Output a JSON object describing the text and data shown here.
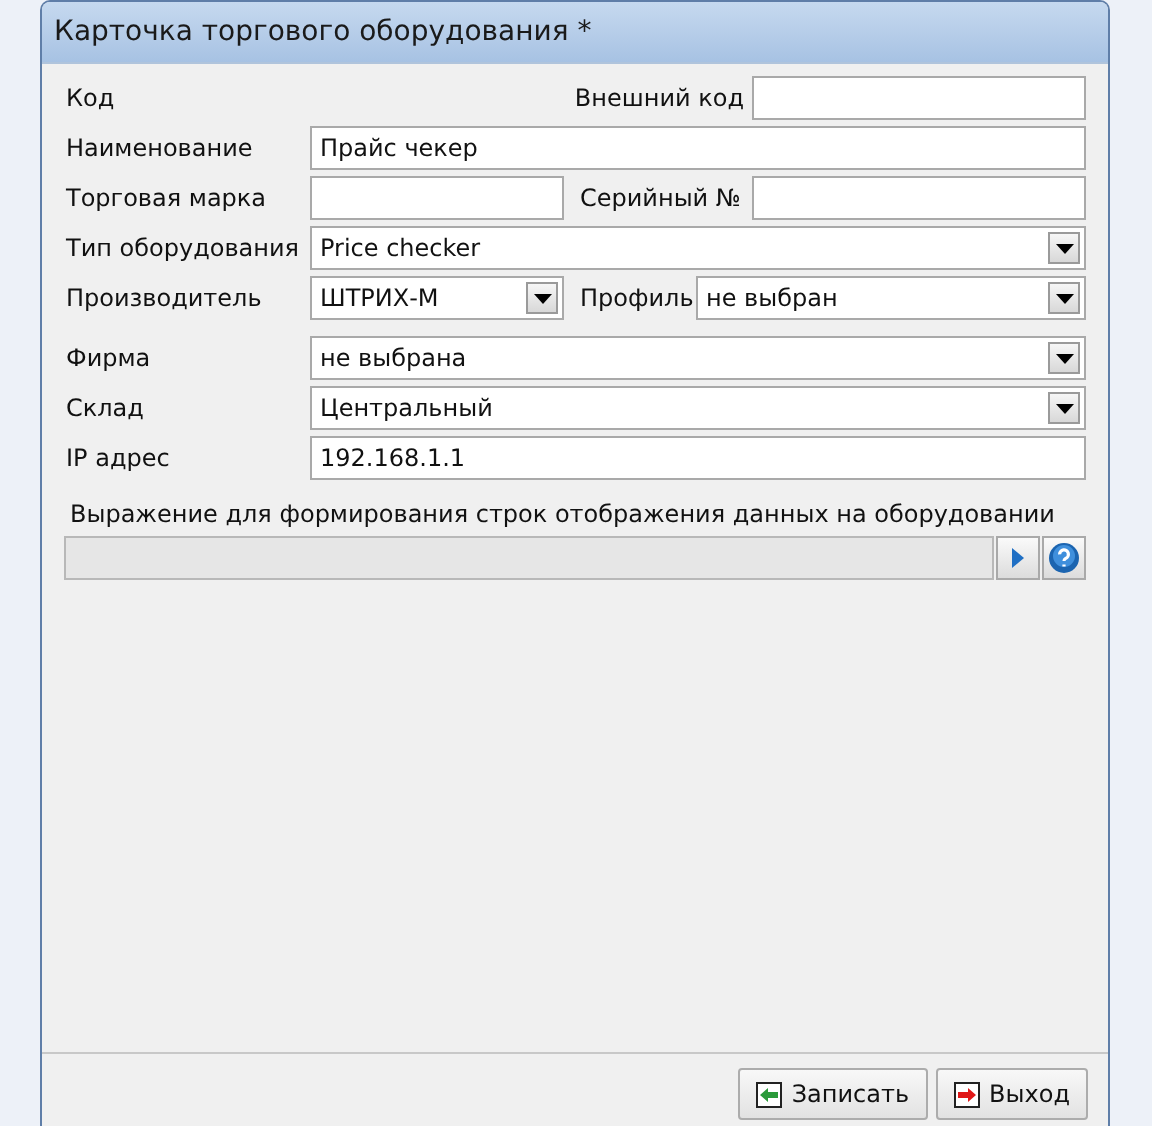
{
  "window": {
    "title": "Карточка торгового оборудования *"
  },
  "groups": [
    {
      "rows": [
        {
          "kind": "code",
          "label": "Код",
          "label_2": "Внешний код",
          "field_2": {
            "kind": "text"
          }
        },
        {
          "kind": "single",
          "label": "Наименование",
          "field": {
            "kind": "text",
            "value": "Прайс чекер"
          }
        },
        {
          "kind": "double",
          "label": "Торговая марка",
          "field": {
            "kind": "text"
          },
          "label_2": "Серийный №",
          "field_2": {
            "kind": "text"
          }
        },
        {
          "kind": "single",
          "label": "Тип оборудования",
          "field": {
            "kind": "combo",
            "value": "Price checker"
          }
        },
        {
          "kind": "double_narrow",
          "label": "Производитель",
          "field": {
            "kind": "combo",
            "value": "ШТРИХ-М"
          },
          "label_2": "Профиль",
          "field_2": {
            "kind": "combo",
            "value": "не выбран"
          }
        }
      ]
    },
    {
      "rows": [
        {
          "kind": "single",
          "label": "Фирма",
          "field": {
            "kind": "combo",
            "value": "не выбрана"
          }
        },
        {
          "kind": "single",
          "label": "Склад",
          "field": {
            "kind": "combo",
            "value": "Центральный"
          }
        },
        {
          "kind": "single",
          "label": "IP адрес",
          "field": {
            "kind": "text",
            "value": "192.168.1.1"
          }
        }
      ]
    }
  ],
  "expression": {
    "label": "Выражение для формирования строк отображения данных на оборудовании",
    "disabled": true
  },
  "buttons": [
    {
      "kind": "save",
      "label": "Записать"
    },
    {
      "kind": "exit",
      "label": "Выход"
    }
  ]
}
